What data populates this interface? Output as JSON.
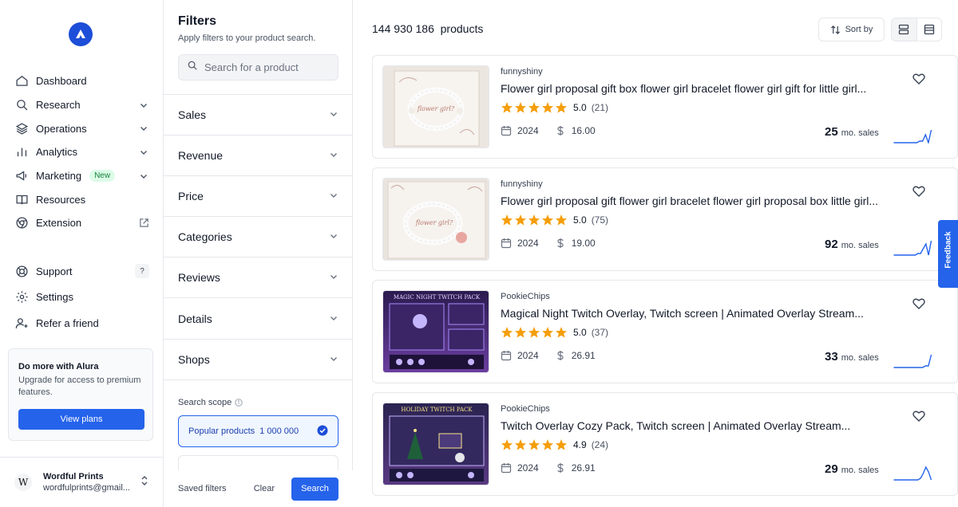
{
  "sidebar": {
    "nav": [
      {
        "label": "Dashboard",
        "icon": "home-icon"
      },
      {
        "label": "Research",
        "icon": "search-icon",
        "expandable": true
      },
      {
        "label": "Operations",
        "icon": "layers-icon",
        "expandable": true
      },
      {
        "label": "Analytics",
        "icon": "bar-chart-icon",
        "expandable": true
      },
      {
        "label": "Marketing",
        "icon": "megaphone-icon",
        "expandable": true,
        "badge": "New"
      },
      {
        "label": "Resources",
        "icon": "book-icon"
      },
      {
        "label": "Extension",
        "icon": "chrome-icon",
        "external": true
      }
    ],
    "secondary": [
      {
        "label": "Support",
        "icon": "lifebuoy-icon",
        "badge": "?"
      },
      {
        "label": "Settings",
        "icon": "gear-icon"
      },
      {
        "label": "Refer a friend",
        "icon": "user-plus-icon"
      }
    ],
    "promo": {
      "title": "Do more with Alura",
      "text": "Upgrade for access to premium features.",
      "button": "View plans"
    },
    "account": {
      "avatar": "W",
      "name": "Wordful Prints",
      "email": "wordfulprints@gmail..."
    }
  },
  "filters": {
    "title": "Filters",
    "subtitle": "Apply filters to your product search.",
    "search_placeholder": "Search for a product",
    "sections": [
      "Sales",
      "Revenue",
      "Price",
      "Categories",
      "Reviews",
      "Details",
      "Shops"
    ],
    "scope_label": "Search scope",
    "scope_option": {
      "label": "Popular products",
      "count": "1 000 000",
      "selected": true
    },
    "footer": {
      "saved": "Saved filters",
      "clear": "Clear",
      "search": "Search"
    }
  },
  "main": {
    "count": "144 930 186",
    "count_suffix": "products",
    "sort_label": "Sort by",
    "sales_suffix": "mo. sales",
    "products": [
      {
        "shop": "funnyshiny",
        "title": "Flower girl proposal gift box flower girl bracelet flower girl gift for little girl...",
        "rating": "5.0",
        "reviews": "(21)",
        "year": "2024",
        "price": "16.00",
        "sales": "25",
        "spark": [
          10,
          10,
          10,
          10,
          10,
          10,
          10,
          10,
          10,
          9,
          9,
          5,
          10,
          2
        ],
        "thumb": "bracelet-box"
      },
      {
        "shop": "funnyshiny",
        "title": "Flower girl proposal gift flower girl bracelet flower girl proposal box little girl...",
        "rating": "5.0",
        "reviews": "(75)",
        "year": "2024",
        "price": "19.00",
        "sales": "92",
        "spark": [
          10,
          10,
          10,
          10,
          10,
          10,
          10,
          10,
          10,
          9,
          9,
          6,
          3,
          10,
          1
        ],
        "thumb": "bracelet-card"
      },
      {
        "shop": "PookieChips",
        "title": "Magical Night Twitch Overlay, Twitch screen | Animated Overlay Stream...",
        "rating": "5.0",
        "reviews": "(37)",
        "year": "2024",
        "price": "26.91",
        "sales": "33",
        "spark": [
          10,
          10,
          10,
          10,
          10,
          10,
          10,
          10,
          10,
          10,
          10,
          9,
          9,
          2
        ],
        "thumb": "magic-night"
      },
      {
        "shop": "PookieChips",
        "title": "Twitch Overlay Cozy Pack, Twitch screen | Animated Overlay Stream...",
        "rating": "4.9",
        "reviews": "(24)",
        "year": "2024",
        "price": "26.91",
        "sales": "29",
        "spark": [
          10,
          10,
          10,
          10,
          10,
          10,
          10,
          10,
          10,
          10,
          9,
          6,
          2,
          5,
          10
        ],
        "thumb": "holiday"
      }
    ]
  },
  "thumb_text": {
    "magic": "MAGIC NIGHT TWITCH PACK",
    "holiday": "HOLIDAY TWITCH PACK"
  },
  "feedback": "Feedback",
  "colors": {
    "accent": "#2563eb",
    "star": "#f59e0b",
    "spark": "#2563eb"
  }
}
